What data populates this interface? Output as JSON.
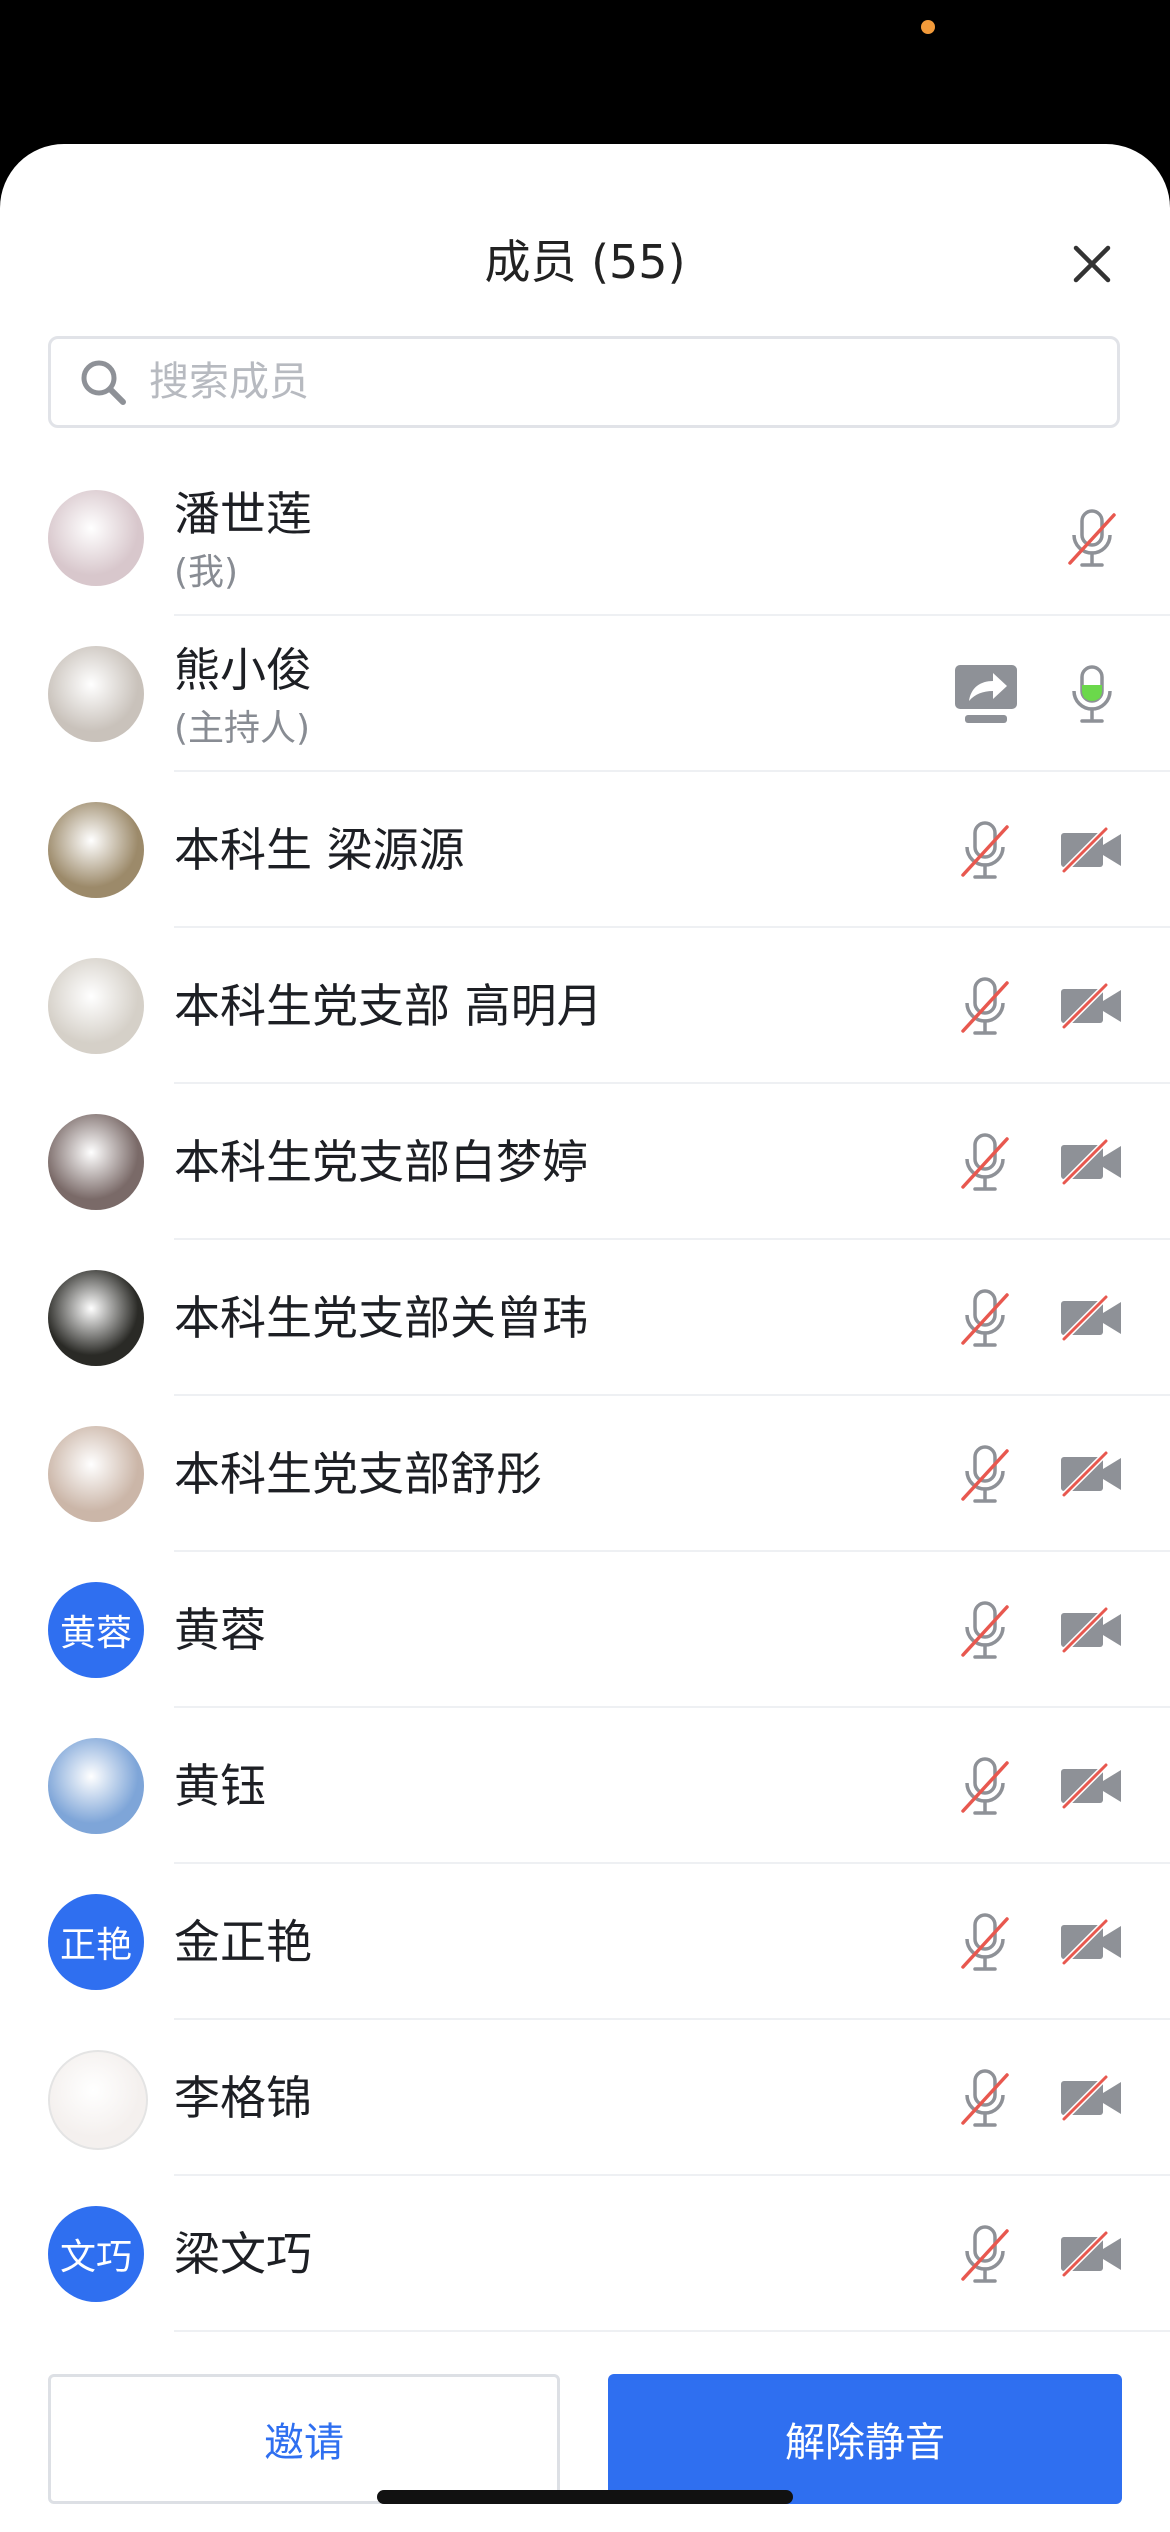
{
  "header": {
    "title": "成员 (55)"
  },
  "search": {
    "placeholder": "搜索成员",
    "value": ""
  },
  "members": [
    {
      "name": "潘世莲",
      "role": "(我)",
      "avatar_type": "photo",
      "avatar_color": "#d8c7cc",
      "mic": "muted-red",
      "camera": "none",
      "sharing": false
    },
    {
      "name": "熊小俊",
      "role": "(主持人)",
      "avatar_type": "photo",
      "avatar_color": "#c9c2bb",
      "mic": "active-green",
      "camera": "none",
      "sharing": true
    },
    {
      "name": "本科生 梁源源",
      "role": "",
      "avatar_type": "photo",
      "avatar_color": "#9c8a6a",
      "mic": "muted",
      "camera": "off",
      "sharing": false
    },
    {
      "name": "本科生党支部 高明月",
      "role": "",
      "avatar_type": "photo",
      "avatar_color": "#d5d0c8",
      "mic": "muted",
      "camera": "off",
      "sharing": false
    },
    {
      "name": "本科生党支部白梦婷",
      "role": "",
      "avatar_type": "photo",
      "avatar_color": "#7a6a68",
      "mic": "muted",
      "camera": "off",
      "sharing": false
    },
    {
      "name": "本科生党支部关曾玮",
      "role": "",
      "avatar_type": "photo",
      "avatar_color": "#2a2a26",
      "mic": "muted",
      "camera": "off",
      "sharing": false
    },
    {
      "name": "本科生党支部舒彤",
      "role": "",
      "avatar_type": "photo",
      "avatar_color": "#cbb6a8",
      "mic": "muted",
      "camera": "off",
      "sharing": false
    },
    {
      "name": "黄蓉",
      "role": "",
      "avatar_type": "text",
      "avatar_text": "黄蓉",
      "mic": "muted",
      "camera": "off",
      "sharing": false
    },
    {
      "name": "黄钰",
      "role": "",
      "avatar_type": "photo",
      "avatar_color": "#7ea5d8",
      "mic": "muted",
      "camera": "off",
      "sharing": false
    },
    {
      "name": "金正艳",
      "role": "",
      "avatar_type": "text",
      "avatar_text": "正艳",
      "mic": "muted",
      "camera": "off",
      "sharing": false
    },
    {
      "name": "李格锦",
      "role": "",
      "avatar_type": "photo",
      "avatar_color": "#f4f0ee",
      "mic": "muted",
      "camera": "off",
      "sharing": false
    },
    {
      "name": "梁文巧",
      "role": "",
      "avatar_type": "text",
      "avatar_text": "文巧",
      "mic": "muted",
      "camera": "off",
      "sharing": false
    }
  ],
  "footer": {
    "invite_label": "邀请",
    "unmute_label": "解除静音"
  },
  "colors": {
    "accent": "#2f6ff0",
    "mute_slash": "#e8584f",
    "active_mic": "#6bd84b",
    "icon_gray": "#8e9197"
  }
}
